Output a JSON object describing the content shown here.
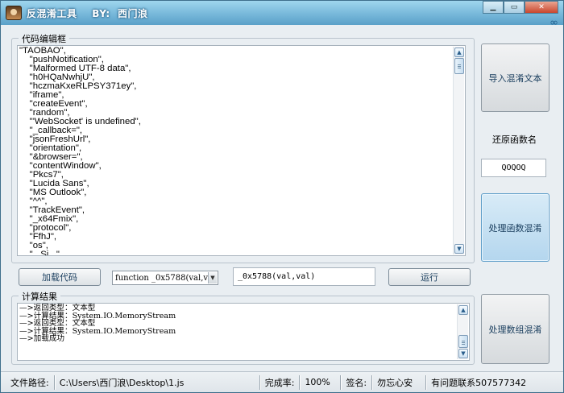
{
  "window": {
    "title": "反混淆工具    BY:  西门浪",
    "controls": {
      "minimize": "▁",
      "restore": "▭",
      "close": "✕"
    },
    "corner_icon": "infinity-icon"
  },
  "editor_group": {
    "title": "代码编辑框",
    "lines": [
      "\"TAOBAO\",",
      "    \"pushNotification\",",
      "    \"Malformed UTF-8 data\",",
      "    \"h0HQaNwhjU\",",
      "    \"hczmaKxeRLPSY371ey\",",
      "    \"iframe\",",
      "    \"createEvent\",",
      "    \"random\",",
      "    \"'WebSocket' is undefined\",",
      "    \"_callback=\",",
      "    \"jsonFreshUrl\",",
      "    \"orientation\",",
      "    \"&browser=\",",
      "    \"contentWindow\",",
      "    \"Pkcs7\",",
      "    \"Lucida Sans\",",
      "    \"MS Outlook\",",
      "    \"^^\",",
      "    \"TrackEvent\",",
      "    \"_x64Fmix\",",
      "    \"protocol\",",
      "    \"FfhJ\",",
      "    \"os\",",
      "    \"...Si...\""
    ]
  },
  "buttons": {
    "import": "导入混淆文本",
    "process_func": "处理函数混淆",
    "process_array": "处理数组混淆",
    "load_code": "加载代码",
    "run": "运行"
  },
  "restore_func": {
    "label": "还原函数名",
    "value": "QOQOQ"
  },
  "function_select": {
    "value": "function _0x5788(val,v"
  },
  "call_input": {
    "value": "_0x5788(val,val)"
  },
  "result_group": {
    "title": "计算结果",
    "lines": [
      "—>返回类型：文本型",
      "—>计算结果：System.IO.MemoryStream",
      "—>返回类型：文本型",
      "—>计算结果：System.IO.MemoryStream",
      "—>加载成功"
    ]
  },
  "statusbar": {
    "path_label": "文件路径:",
    "path_value": "C:\\Users\\西门浪\\Desktop\\1.js",
    "rate_label": "完成率:",
    "rate_value": "100%",
    "sign_label": "签名:",
    "sign_value": "勿忘心安",
    "contact": "有问题联系507577342"
  }
}
